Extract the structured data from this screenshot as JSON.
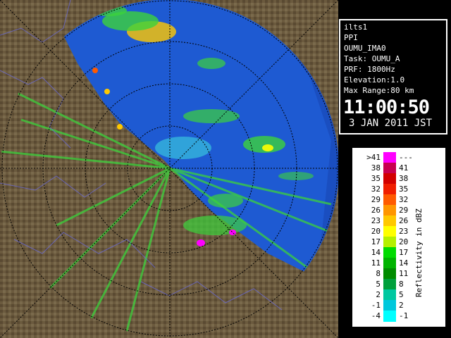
{
  "info": {
    "lines": [
      "ilts1",
      "PPI",
      "OUMU_IMA0",
      "Task: OUMU_A",
      "PRF: 1800Hz",
      "Elevation:1.0",
      "Max Range:80 km"
    ],
    "time": "11:00:50",
    "date": "3 JAN 2011 JST"
  },
  "legend": {
    "title": "Reflectivity in dBZ",
    "rows": [
      {
        "lo": ">41",
        "hi": "---",
        "color": "#ff00ff"
      },
      {
        "lo": "38",
        "hi": "41",
        "color": "#c80050"
      },
      {
        "lo": "35",
        "hi": "38",
        "color": "#d20000"
      },
      {
        "lo": "32",
        "hi": "35",
        "color": "#f01e00"
      },
      {
        "lo": "29",
        "hi": "32",
        "color": "#ff5a00"
      },
      {
        "lo": "26",
        "hi": "29",
        "color": "#ff9600"
      },
      {
        "lo": "23",
        "hi": "26",
        "color": "#ffc800"
      },
      {
        "lo": "20",
        "hi": "23",
        "color": "#ffff00"
      },
      {
        "lo": "17",
        "hi": "20",
        "color": "#b4f000"
      },
      {
        "lo": "14",
        "hi": "17",
        "color": "#00dc00"
      },
      {
        "lo": "11",
        "hi": "14",
        "color": "#00b400"
      },
      {
        "lo": "8",
        "hi": "11",
        "color": "#008c00"
      },
      {
        "lo": "5",
        "hi": "8",
        "color": "#00a03c"
      },
      {
        "lo": "2",
        "hi": "5",
        "color": "#00c8a0"
      },
      {
        "lo": "-1",
        "hi": "2",
        "color": "#00c8dc"
      },
      {
        "lo": "-4",
        "hi": "-1",
        "color": "#00ffff"
      }
    ]
  },
  "colors": {
    "land": "#6b5a3e",
    "sea": "#1e5ad2",
    "sea_far": "#0a2896",
    "echo_green": "#3cd23c",
    "echo_cyan": "#40e0e0"
  }
}
